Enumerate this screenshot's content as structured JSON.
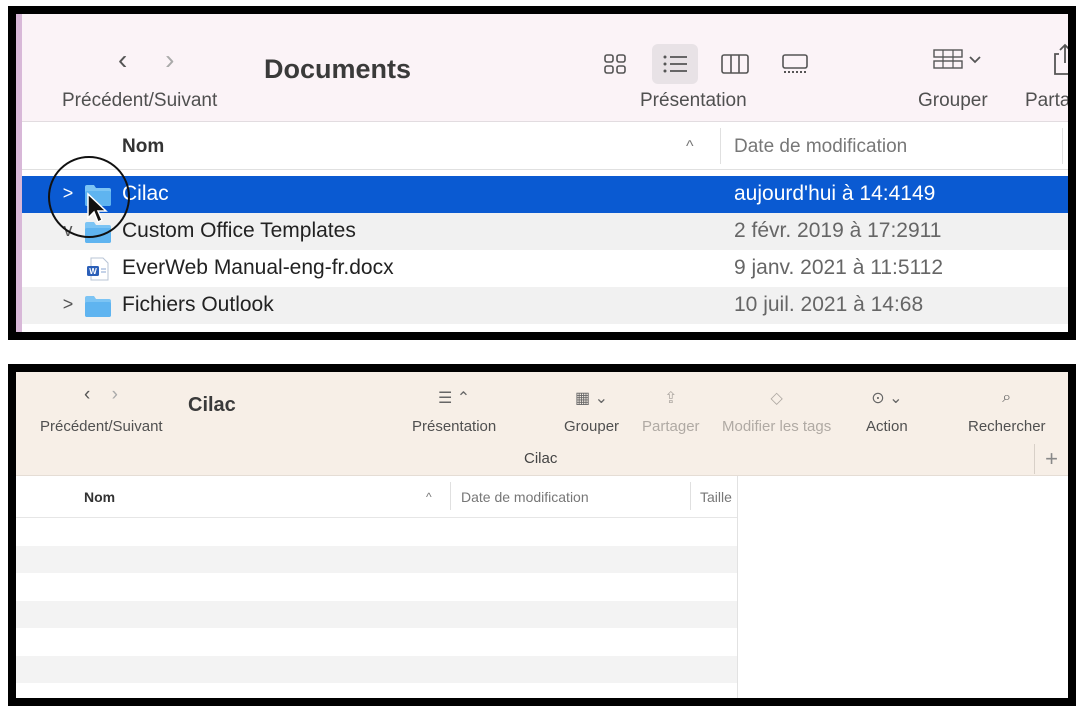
{
  "panel_top": {
    "nav": {
      "back_glyph": "‹",
      "forward_glyph": "›",
      "label": "Précédent/Suivant"
    },
    "title": "Documents",
    "toolbar": {
      "view_label": "Présentation",
      "group_label": "Grouper",
      "share_label": "Partag"
    },
    "columns": {
      "name": "Nom",
      "sort_indicator": "^",
      "date": "Date de modification"
    },
    "rows": [
      {
        "name": "Cilac",
        "date": "aujourd'hui à 14:4149",
        "type": "folder",
        "disclosure": ">",
        "selected": true
      },
      {
        "name": "Custom Office Templates",
        "date": "2 févr. 2019 à 17:2911",
        "type": "folder",
        "disclosure": "v",
        "selected": false
      },
      {
        "name": "EverWeb Manual-eng-fr.docx",
        "date": "9 janv. 2021 à 11:5112",
        "type": "docx",
        "disclosure": "",
        "selected": false
      },
      {
        "name": "Fichiers Outlook",
        "date": "10 juil. 2021 à 14:68",
        "type": "folder",
        "disclosure": ">",
        "selected": false
      }
    ],
    "colors": {
      "selection": "#0a5ad2",
      "folder": "#5fb4f0",
      "toolbar_bg": "#fbf3f7"
    }
  },
  "panel_bottom": {
    "nav": {
      "back_glyph": "‹",
      "forward_glyph": "›",
      "label": "Précédent/Suivant"
    },
    "title": "Cilac",
    "toolbar": [
      {
        "icon": "list-view-icon",
        "glyph": "☰ ⌃",
        "label": "Présentation",
        "enabled": true
      },
      {
        "icon": "group-icon",
        "glyph": "▦ ⌄",
        "label": "Grouper",
        "enabled": true
      },
      {
        "icon": "share-icon",
        "glyph": "⇪",
        "label": "Partager",
        "enabled": false
      },
      {
        "icon": "tag-icon",
        "glyph": "◇",
        "label": "Modifier les tags",
        "enabled": false
      },
      {
        "icon": "action-icon",
        "glyph": "⊙ ⌄",
        "label": "Action",
        "enabled": true
      },
      {
        "icon": "search-icon",
        "glyph": "⌕",
        "label": "Rechercher",
        "enabled": true
      }
    ],
    "path_label": "Cilac",
    "plus": "+",
    "columns": {
      "name": "Nom",
      "sort_indicator": "^",
      "date": "Date de modification",
      "size": "Taille"
    },
    "colors": {
      "toolbar_bg": "#f7efe7"
    }
  }
}
